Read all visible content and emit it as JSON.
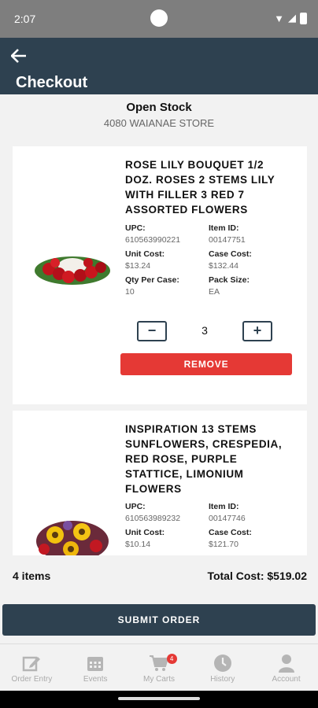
{
  "status_bar": {
    "time": "2:07"
  },
  "app_bar": {
    "title": "Checkout"
  },
  "store": {
    "name": "Open Stock",
    "location": "4080 WAIANAE STORE"
  },
  "items": [
    {
      "title": "ROSE LILY BOUQUET 1/2 DOZ. ROSES 2 STEMS LILY WITH FILLER 3 RED 7 ASSORTED FLOWERS",
      "upc_label": "UPC:",
      "upc": "610563990221",
      "item_id_label": "Item ID:",
      "item_id": "00147751",
      "unit_cost_label": "Unit Cost:",
      "unit_cost": "$13.24",
      "case_cost_label": "Case Cost:",
      "case_cost": "$132.44",
      "qty_per_case_label": "Qty Per Case:",
      "qty_per_case": "10",
      "pack_size_label": "Pack Size:",
      "pack_size": "EA",
      "quantity": "3",
      "minus_symbol": "−",
      "plus_symbol": "+",
      "remove_label": "REMOVE"
    },
    {
      "title": "INSPIRATION 13 STEMS SUNFLOWERS, CRESPEDIA, RED ROSE, PURPLE STATTICE, LIMONIUM FLOWERS",
      "upc_label": "UPC:",
      "upc": "610563989232",
      "item_id_label": "Item ID:",
      "item_id": "00147746",
      "unit_cost_label": "Unit Cost:",
      "unit_cost": "$10.14",
      "case_cost_label": "Case Cost:",
      "case_cost": "$121.70"
    }
  ],
  "summary": {
    "count": "4 items",
    "total": "Total Cost: $519.02"
  },
  "submit_label": "SUBMIT ORDER",
  "nav": [
    {
      "label": "Order Entry",
      "icon": "edit-icon"
    },
    {
      "label": "Events",
      "icon": "calendar-icon"
    },
    {
      "label": "My Carts",
      "icon": "cart-icon",
      "badge": "4"
    },
    {
      "label": "History",
      "icon": "clock-icon"
    },
    {
      "label": "Account",
      "icon": "person-icon"
    }
  ],
  "colors": {
    "primary": "#2e4150",
    "danger": "#e53935",
    "background": "#f2f2f2"
  }
}
